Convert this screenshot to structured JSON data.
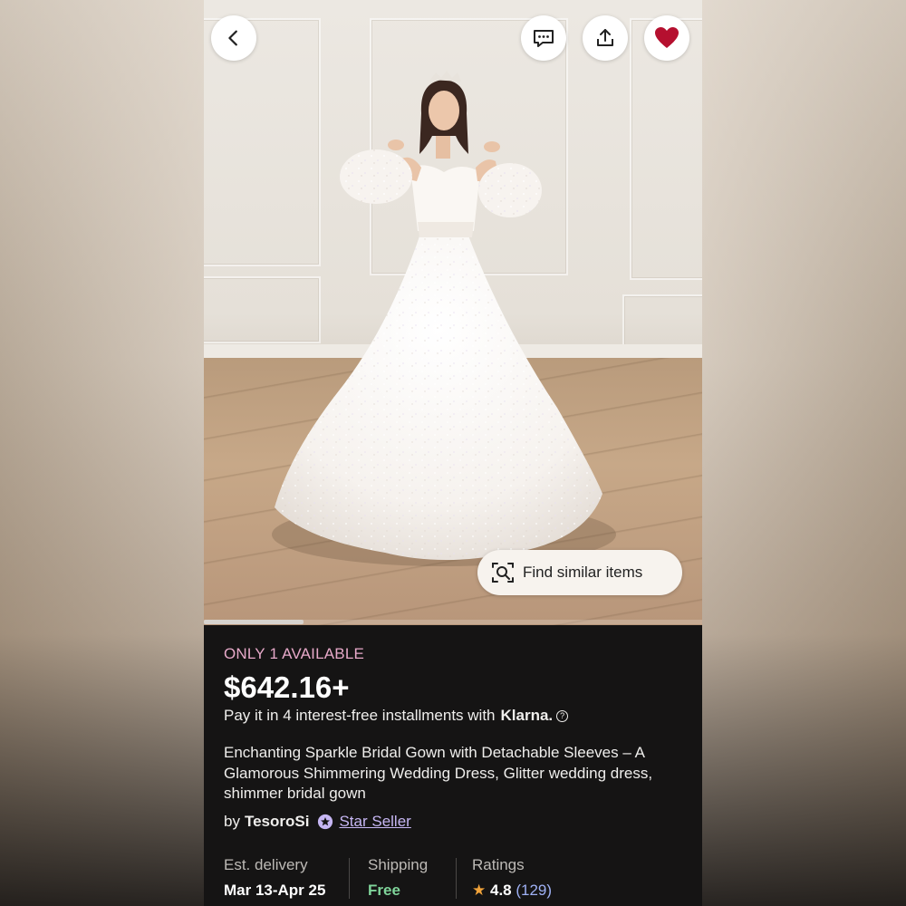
{
  "header": {
    "back_icon": "chevron-left-icon",
    "message_icon": "message-icon",
    "share_icon": "share-icon",
    "favorite_icon": "heart-icon",
    "favorite_color": "#b5102f"
  },
  "photo": {
    "find_similar_label": "Find similar items",
    "find_similar_icon": "visual-search-icon",
    "carousel_progress": 0.2
  },
  "product": {
    "availability": "ONLY 1 AVAILABLE",
    "price": "$642.16+",
    "installments_text": "Pay it in 4 interest-free installments with",
    "installments_provider": "Klarna.",
    "help_icon": "question-icon",
    "title": "Enchanting Sparkle Bridal Gown with Detachable Sleeves – A Glamorous Shimmering Wedding Dress, Glitter wedding dress, shimmer bridal gown",
    "seller_prefix": "by",
    "seller_name": "TesoroSi",
    "seller_badge": "Star Seller",
    "seller_badge_icon": "star-seller-icon"
  },
  "info": {
    "delivery_label": "Est. delivery",
    "delivery_value": "Mar 13-Apr 25",
    "shipping_label": "Shipping",
    "shipping_value": "Free",
    "ratings_label": "Ratings",
    "ratings_star": "★",
    "ratings_value": "4.8",
    "ratings_count": "(129)"
  },
  "colors": {
    "availability": "#e7a9c9",
    "shipping_free": "#7fd49a",
    "star_seller": "#c6b6f3",
    "ratings_count": "#9fb1f5",
    "star": "#f1a33a"
  }
}
